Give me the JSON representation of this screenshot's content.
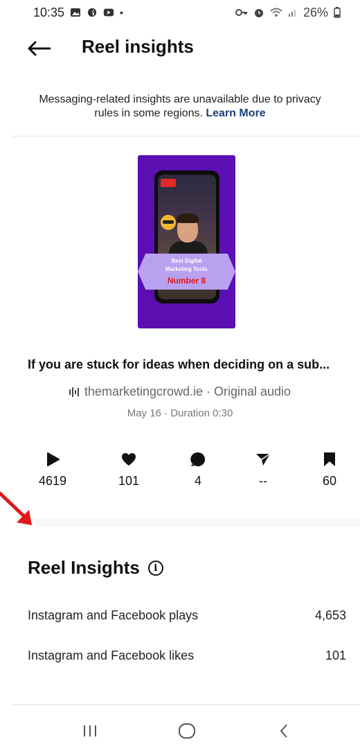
{
  "status_bar": {
    "time": "10:35",
    "battery": "26%",
    "icons_left": [
      "gallery-icon",
      "facebook-icon",
      "youtube-icon",
      "dot-icon"
    ],
    "icons_right": [
      "vpn-key-icon",
      "alarm-icon",
      "wifi-icon",
      "signal-icon",
      "battery-icon"
    ]
  },
  "header": {
    "title": "Reel insights",
    "back_icon": "arrow-left-icon"
  },
  "notice": {
    "text": "Messaging-related insights are unavailable due to privacy rules in some regions.",
    "link": "Learn More"
  },
  "reel": {
    "thumbnail": {
      "banner_line1": "Best Digital",
      "banner_line2": "Marketing Tools",
      "banner_line3": "Number 8",
      "background_color": "#5b0fb3"
    },
    "caption": "If you are stuck for ideas when deciding on a  sub...",
    "audio": "themarketingcrowd.ie · Original audio",
    "meta": "May 16 · Duration 0:30"
  },
  "stats": [
    {
      "icon": "play-icon",
      "value": "4619"
    },
    {
      "icon": "heart-icon",
      "value": "101"
    },
    {
      "icon": "comment-icon",
      "value": "4"
    },
    {
      "icon": "send-icon",
      "value": "--"
    },
    {
      "icon": "bookmark-icon",
      "value": "60"
    }
  ],
  "insights": {
    "title": "Reel Insights",
    "info_icon": "ⓘ",
    "rows": [
      {
        "label": "Instagram and Facebook plays",
        "value": "4,653"
      },
      {
        "label": "Instagram and Facebook likes",
        "value": "101"
      }
    ]
  },
  "nav": {
    "recents_icon": "recents-icon",
    "home_icon": "home-icon",
    "back_icon": "back-chevron-icon"
  },
  "colors": {
    "accent_link": "#1c3f7a",
    "annotation_arrow": "#e01919"
  }
}
